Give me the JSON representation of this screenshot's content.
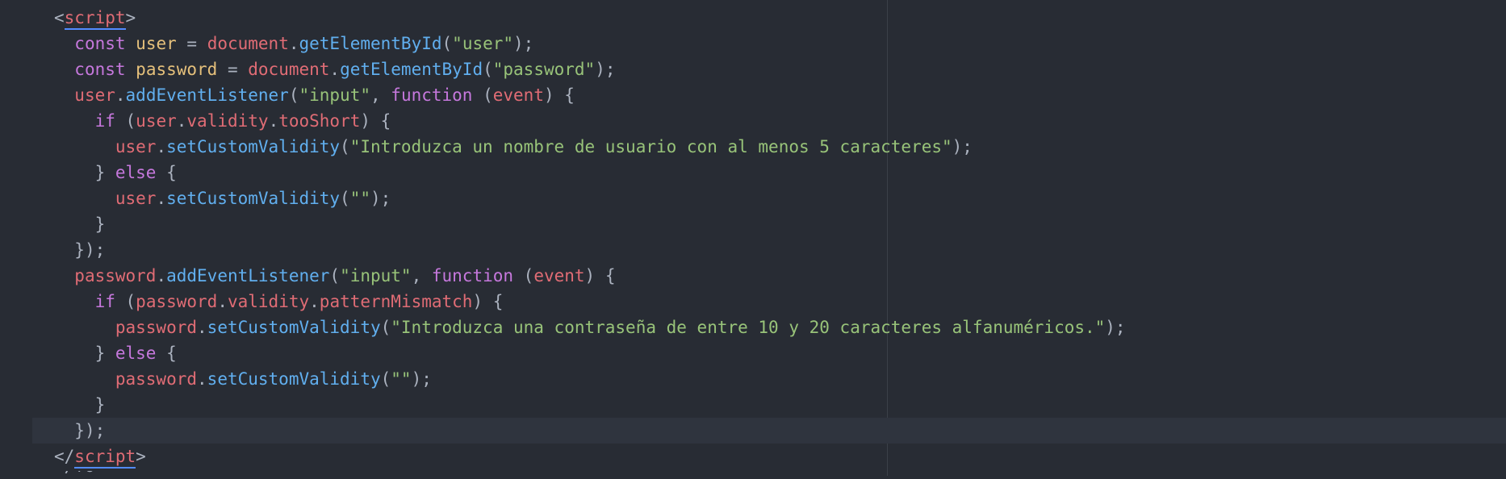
{
  "editor": {
    "theme_colors": {
      "background": "#282c34",
      "keyword": "#c678dd",
      "variable": "#e5c07b",
      "object": "#e06c75",
      "function": "#61afef",
      "property": "#56b6c2",
      "string": "#98c379",
      "punctuation": "#abb2bf"
    },
    "lines": [
      [
        {
          "t": "<",
          "c": "punct"
        },
        {
          "t": "script",
          "c": "tag",
          "u": true
        },
        {
          "t": ">",
          "c": "punct"
        }
      ],
      [
        {
          "t": "  "
        },
        {
          "t": "const",
          "c": "kw"
        },
        {
          "t": " "
        },
        {
          "t": "user",
          "c": "var"
        },
        {
          "t": " = ",
          "c": "punct"
        },
        {
          "t": "document",
          "c": "obj"
        },
        {
          "t": ".",
          "c": "punct"
        },
        {
          "t": "getElementById",
          "c": "fn"
        },
        {
          "t": "(",
          "c": "punct"
        },
        {
          "t": "\"user\"",
          "c": "str"
        },
        {
          "t": ");",
          "c": "punct"
        }
      ],
      [
        {
          "t": "  "
        },
        {
          "t": "const",
          "c": "kw"
        },
        {
          "t": " "
        },
        {
          "t": "password",
          "c": "var"
        },
        {
          "t": " = ",
          "c": "punct"
        },
        {
          "t": "document",
          "c": "obj"
        },
        {
          "t": ".",
          "c": "punct"
        },
        {
          "t": "getElementById",
          "c": "fn"
        },
        {
          "t": "(",
          "c": "punct"
        },
        {
          "t": "\"password\"",
          "c": "str"
        },
        {
          "t": ");",
          "c": "punct"
        }
      ],
      [
        {
          "t": "  "
        },
        {
          "t": "user",
          "c": "obj"
        },
        {
          "t": ".",
          "c": "punct"
        },
        {
          "t": "addEventListener",
          "c": "fn"
        },
        {
          "t": "(",
          "c": "punct"
        },
        {
          "t": "\"input\"",
          "c": "str"
        },
        {
          "t": ", ",
          "c": "punct"
        },
        {
          "t": "function",
          "c": "kw"
        },
        {
          "t": " (",
          "c": "punct"
        },
        {
          "t": "event",
          "c": "obj"
        },
        {
          "t": ") {",
          "c": "punct"
        }
      ],
      [
        {
          "t": "    "
        },
        {
          "t": "if",
          "c": "kw"
        },
        {
          "t": " (",
          "c": "punct"
        },
        {
          "t": "user",
          "c": "obj"
        },
        {
          "t": ".",
          "c": "punct"
        },
        {
          "t": "validity",
          "c": "obj"
        },
        {
          "t": ".",
          "c": "punct"
        },
        {
          "t": "tooShort",
          "c": "obj"
        },
        {
          "t": ") {",
          "c": "punct"
        }
      ],
      [
        {
          "t": "      "
        },
        {
          "t": "user",
          "c": "obj"
        },
        {
          "t": ".",
          "c": "punct"
        },
        {
          "t": "setCustomValidity",
          "c": "fn"
        },
        {
          "t": "(",
          "c": "punct"
        },
        {
          "t": "\"Introduzca un nombre de usuario con al menos 5 caracteres\"",
          "c": "str"
        },
        {
          "t": ");",
          "c": "punct"
        }
      ],
      [
        {
          "t": "    "
        },
        {
          "t": "} ",
          "c": "punct"
        },
        {
          "t": "else",
          "c": "kw"
        },
        {
          "t": " {",
          "c": "punct"
        }
      ],
      [
        {
          "t": "      "
        },
        {
          "t": "user",
          "c": "obj"
        },
        {
          "t": ".",
          "c": "punct"
        },
        {
          "t": "setCustomValidity",
          "c": "fn"
        },
        {
          "t": "(",
          "c": "punct"
        },
        {
          "t": "\"\"",
          "c": "str"
        },
        {
          "t": ");",
          "c": "punct"
        }
      ],
      [
        {
          "t": "    "
        },
        {
          "t": "}",
          "c": "punct"
        }
      ],
      [
        {
          "t": "  "
        },
        {
          "t": "});",
          "c": "punct"
        }
      ],
      [
        {
          "t": "  "
        },
        {
          "t": "password",
          "c": "obj"
        },
        {
          "t": ".",
          "c": "punct"
        },
        {
          "t": "addEventListener",
          "c": "fn"
        },
        {
          "t": "(",
          "c": "punct"
        },
        {
          "t": "\"input\"",
          "c": "str"
        },
        {
          "t": ", ",
          "c": "punct"
        },
        {
          "t": "function",
          "c": "kw"
        },
        {
          "t": " (",
          "c": "punct"
        },
        {
          "t": "event",
          "c": "obj"
        },
        {
          "t": ") {",
          "c": "punct"
        }
      ],
      [
        {
          "t": "    "
        },
        {
          "t": "if",
          "c": "kw"
        },
        {
          "t": " (",
          "c": "punct"
        },
        {
          "t": "password",
          "c": "obj"
        },
        {
          "t": ".",
          "c": "punct"
        },
        {
          "t": "validity",
          "c": "obj"
        },
        {
          "t": ".",
          "c": "punct"
        },
        {
          "t": "patternMismatch",
          "c": "obj"
        },
        {
          "t": ") {",
          "c": "punct"
        }
      ],
      [
        {
          "t": "      "
        },
        {
          "t": "password",
          "c": "obj"
        },
        {
          "t": ".",
          "c": "punct"
        },
        {
          "t": "setCustomValidity",
          "c": "fn"
        },
        {
          "t": "(",
          "c": "punct"
        },
        {
          "t": "\"Introduzca una contraseña de entre 10 y 20 caracteres alfanuméricos.\"",
          "c": "str"
        },
        {
          "t": ");",
          "c": "punct"
        }
      ],
      [
        {
          "t": "    "
        },
        {
          "t": "} ",
          "c": "punct"
        },
        {
          "t": "else",
          "c": "kw"
        },
        {
          "t": " {",
          "c": "punct"
        }
      ],
      [
        {
          "t": "      "
        },
        {
          "t": "password",
          "c": "obj"
        },
        {
          "t": ".",
          "c": "punct"
        },
        {
          "t": "setCustomValidity",
          "c": "fn"
        },
        {
          "t": "(",
          "c": "punct"
        },
        {
          "t": "\"\"",
          "c": "str"
        },
        {
          "t": ");",
          "c": "punct"
        }
      ],
      [
        {
          "t": "    "
        },
        {
          "t": "}",
          "c": "punct"
        }
      ],
      [
        {
          "t": "  "
        },
        {
          "t": "});",
          "c": "punct"
        }
      ],
      [
        {
          "t": "</",
          "c": "punct"
        },
        {
          "t": "script",
          "c": "tag",
          "u": true
        },
        {
          "t": ">",
          "c": "punct"
        }
      ]
    ],
    "active_line": 16,
    "cut_off_text": "</fo"
  }
}
